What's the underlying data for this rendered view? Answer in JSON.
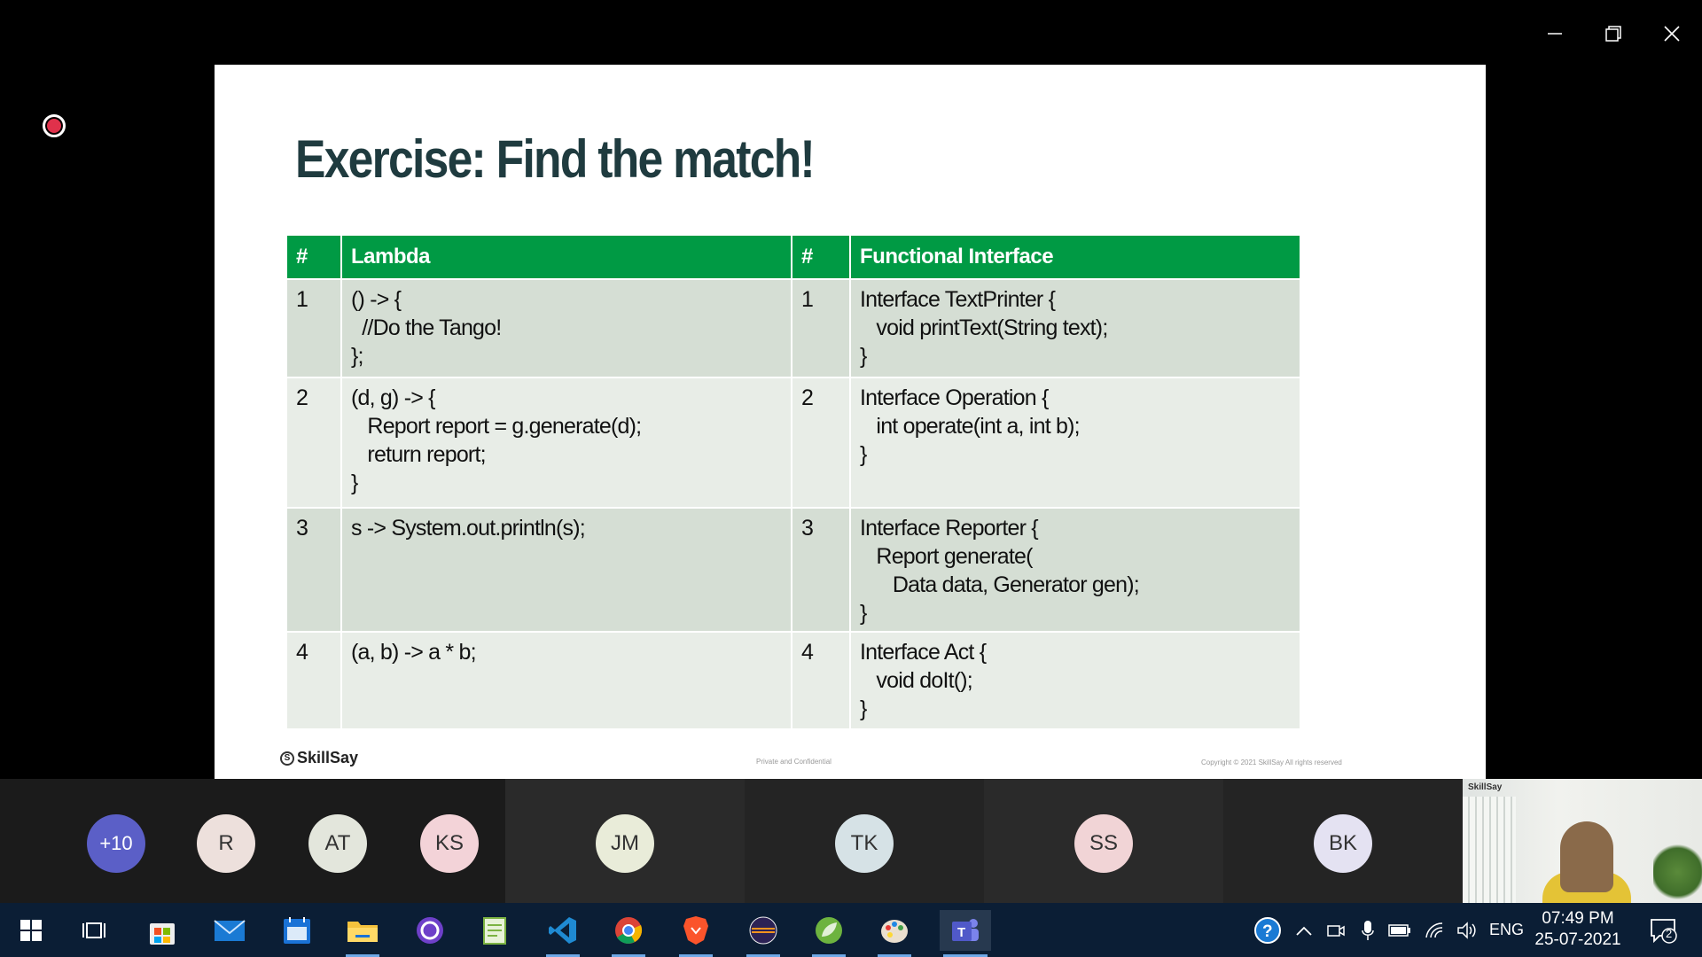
{
  "window": {
    "controls": {
      "minimize": "minimize",
      "maximize": "restore",
      "close": "close"
    }
  },
  "slide": {
    "title": "Exercise: Find the match!",
    "table": {
      "headers": [
        "#",
        "Lambda",
        "#",
        "Functional Interface"
      ],
      "rows": [
        {
          "n1": "1",
          "lambda": "() -> {\n  //Do the Tango!\n};",
          "n2": "1",
          "iface": "Interface TextPrinter {\n   void printText(String text);\n}"
        },
        {
          "n1": "2",
          "lambda": "(d, g) -> {\n   Report report = g.generate(d);\n   return report;\n}",
          "n2": "2",
          "iface": "Interface Operation {\n   int operate(int a, int b);\n}"
        },
        {
          "n1": "3",
          "lambda": "s -> System.out.println(s);",
          "n2": "3",
          "iface": "Interface Reporter {\n   Report generate(\n      Data data, Generator gen);\n}"
        },
        {
          "n1": "4",
          "lambda": "(a, b) -> a * b;",
          "n2": "4",
          "iface": "Interface Act {\n   void doIt();\n}"
        }
      ]
    },
    "logo": "SkillSay",
    "private_note": "Private and Confidential",
    "copyright": "Copyright © 2021 SkillSay All rights reserved"
  },
  "participants": {
    "overflow": "+10",
    "people": [
      {
        "initials": "R",
        "color": "#ede0dc"
      },
      {
        "initials": "AT",
        "color": "#e3e6dc"
      },
      {
        "initials": "KS",
        "color": "#f3d3d8"
      },
      {
        "initials": "JM",
        "color": "#e9ecd9"
      },
      {
        "initials": "TK",
        "color": "#d6e2e6"
      },
      {
        "initials": "SS",
        "color": "#f1d4d6"
      },
      {
        "initials": "BK",
        "color": "#e4e2f2"
      }
    ],
    "self_view_tag": "SkillSay"
  },
  "taskbar": {
    "apps": [
      "start",
      "task-view",
      "store",
      "mail",
      "calendar",
      "file-explorer",
      "github-desktop",
      "notepad",
      "vscode",
      "chrome",
      "brave",
      "eclipse",
      "spring-tool-suite",
      "paint",
      "teams"
    ],
    "tray": {
      "language": "ENG",
      "time": "07:49 PM",
      "date": "25-07-2021",
      "notifications": "2"
    }
  },
  "colors": {
    "header_green": "#009a44",
    "row_dark": "#d5ded4",
    "row_light": "#e8ede7",
    "taskbar": "#0b1e35"
  }
}
